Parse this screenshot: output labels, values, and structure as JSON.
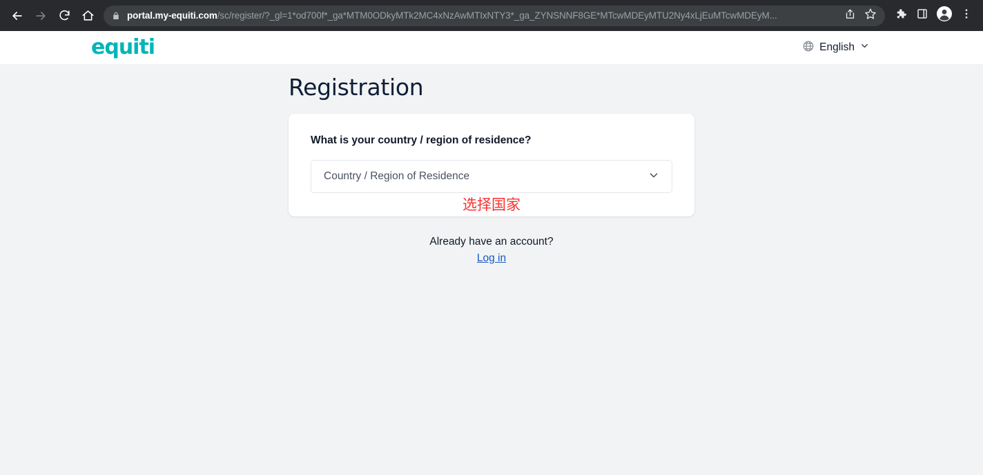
{
  "browser": {
    "nav": {
      "back_icon": "arrow-left-icon",
      "forward_icon": "arrow-right-icon",
      "reload_icon": "reload-icon",
      "home_icon": "home-icon"
    },
    "omnibox": {
      "lock_icon": "lock-icon",
      "host": "portal.my-equiti.com",
      "path": "/sc/register/?_gl=1*od700f*_ga*MTM0ODkyMTk2MC4xNzAwMTIxNTY3*_ga_ZYNSNNF8GE*MTcwMDEyMTU2Ny4xLjEuMTcwMDEyM...",
      "share_icon": "share-icon",
      "bookmark_icon": "star-icon"
    },
    "toolbar_right": {
      "extensions_icon": "puzzle-icon",
      "side_panel_icon": "side-panel-icon",
      "profile_icon": "profile-avatar-icon",
      "menu_icon": "three-dot-menu-icon"
    }
  },
  "site": {
    "logo_text": "equiti",
    "logo_color": "#00b5b8",
    "language": {
      "globe_icon": "globe-icon",
      "label": "English",
      "chevron_icon": "chevron-down-icon"
    }
  },
  "main": {
    "title": "Registration",
    "card": {
      "question": "What is your country / region of residence?",
      "select": {
        "placeholder": "Country / Region of Residence",
        "value": "",
        "chevron_icon": "chevron-down-icon"
      },
      "annotation": {
        "text": "选择国家",
        "color": "#f8312f"
      }
    },
    "footer": {
      "account_prompt": "Already have an account?",
      "login_link": "Log in",
      "link_color": "#1a56c4"
    }
  }
}
